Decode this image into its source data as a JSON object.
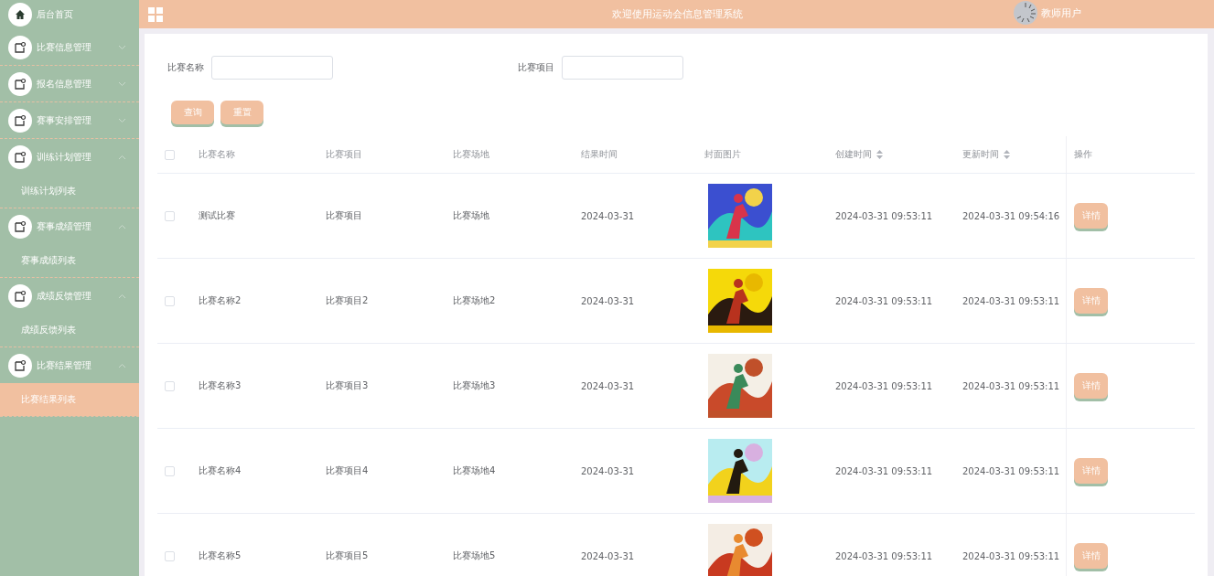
{
  "sidebar": {
    "items": [
      {
        "kind": "link",
        "label": "后台首页"
      },
      {
        "kind": "menu",
        "label": "比赛信息管理",
        "expanded": false
      },
      {
        "kind": "menu",
        "label": "报名信息管理",
        "expanded": false
      },
      {
        "kind": "menu",
        "label": "赛事安排管理",
        "expanded": false
      },
      {
        "kind": "menu",
        "label": "训练计划管理",
        "expanded": true,
        "children": [
          {
            "label": "训练计划列表",
            "selected": false
          }
        ]
      },
      {
        "kind": "menu",
        "label": "赛事成绩管理",
        "expanded": true,
        "children": [
          {
            "label": "赛事成绩列表",
            "selected": false
          }
        ]
      },
      {
        "kind": "menu",
        "label": "成绩反馈管理",
        "expanded": true,
        "children": [
          {
            "label": "成绩反馈列表",
            "selected": false
          }
        ]
      },
      {
        "kind": "menu",
        "label": "比赛结果管理",
        "expanded": true,
        "children": [
          {
            "label": "比赛结果列表",
            "selected": true
          }
        ]
      }
    ]
  },
  "header": {
    "title": "欢迎使用运动会信息管理系统",
    "user": "教师用户"
  },
  "search": {
    "fields": [
      {
        "label": "比赛名称"
      },
      {
        "label": "比赛项目"
      }
    ],
    "buttons": [
      "查询",
      "重置"
    ]
  },
  "table": {
    "select_all": {
      "checked": false
    },
    "columns": [
      {
        "label": "比赛名称",
        "sortable": false
      },
      {
        "label": "比赛项目",
        "sortable": false
      },
      {
        "label": "比赛场地",
        "sortable": false
      },
      {
        "label": "结果时间",
        "sortable": false
      },
      {
        "label": "封面图片",
        "sortable": false
      },
      {
        "label": "创建时间",
        "sortable": true
      },
      {
        "label": "更新时间",
        "sortable": true
      },
      {
        "label": "操作",
        "sortable": false
      }
    ],
    "rows": [
      {
        "checked": false,
        "cells": [
          "测试比赛",
          "比赛项目",
          "比赛场地",
          "2024-03-31"
        ],
        "cover": {
          "kind": "picture"
        },
        "created": "2024-03-31 09:53:11",
        "updated": "2024-03-31 09:54:16",
        "action": "详情"
      },
      {
        "checked": false,
        "cells": [
          "比赛名称2",
          "比赛项目2",
          "比赛场地2",
          "2024-03-31"
        ],
        "cover": {
          "kind": "picture"
        },
        "created": "2024-03-31 09:53:11",
        "updated": "2024-03-31 09:53:11",
        "action": "详情"
      },
      {
        "checked": false,
        "cells": [
          "比赛名称3",
          "比赛项目3",
          "比赛场地3",
          "2024-03-31"
        ],
        "cover": {
          "kind": "picture"
        },
        "created": "2024-03-31 09:53:11",
        "updated": "2024-03-31 09:53:11",
        "action": "详情"
      },
      {
        "checked": false,
        "cells": [
          "比赛名称4",
          "比赛项目4",
          "比赛场地4",
          "2024-03-31"
        ],
        "cover": {
          "kind": "picture"
        },
        "created": "2024-03-31 09:53:11",
        "updated": "2024-03-31 09:53:11",
        "action": "详情"
      },
      {
        "checked": false,
        "cells": [
          "比赛名称5",
          "比赛项目5",
          "比赛场地5",
          "2024-03-31"
        ],
        "cover": {
          "kind": "picture"
        },
        "created": "2024-03-31 09:53:11",
        "updated": "2024-03-31 09:53:11",
        "action": "详情"
      }
    ]
  }
}
